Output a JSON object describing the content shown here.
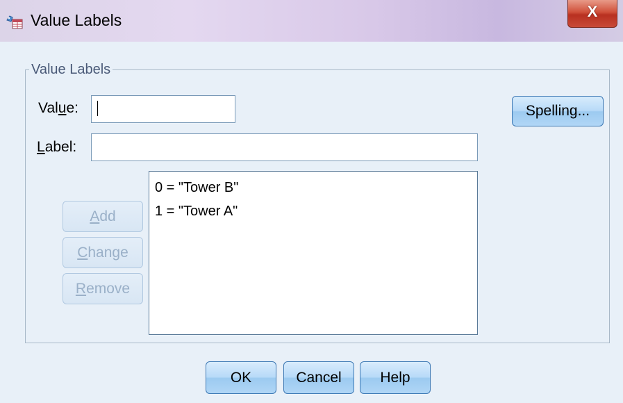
{
  "window": {
    "title": "Value Labels",
    "close_label": "X"
  },
  "group": {
    "label": "Value Labels"
  },
  "value_field": {
    "label_pre": "Val",
    "label_mnemonic": "u",
    "label_post": "e:",
    "value": ""
  },
  "label_field": {
    "label_mnemonic": "L",
    "label_post": "abel:",
    "value": ""
  },
  "buttons": {
    "spelling": "Spelling...",
    "add_mnemonic": "A",
    "add_post": "dd",
    "change_mnemonic": "C",
    "change_post": "hange",
    "remove_mnemonic": "R",
    "remove_post": "emove",
    "ok": "OK",
    "cancel": "Cancel",
    "help": "Help"
  },
  "list": {
    "items": [
      "0 = \"Tower B\"",
      "1 = \"Tower A\""
    ]
  }
}
